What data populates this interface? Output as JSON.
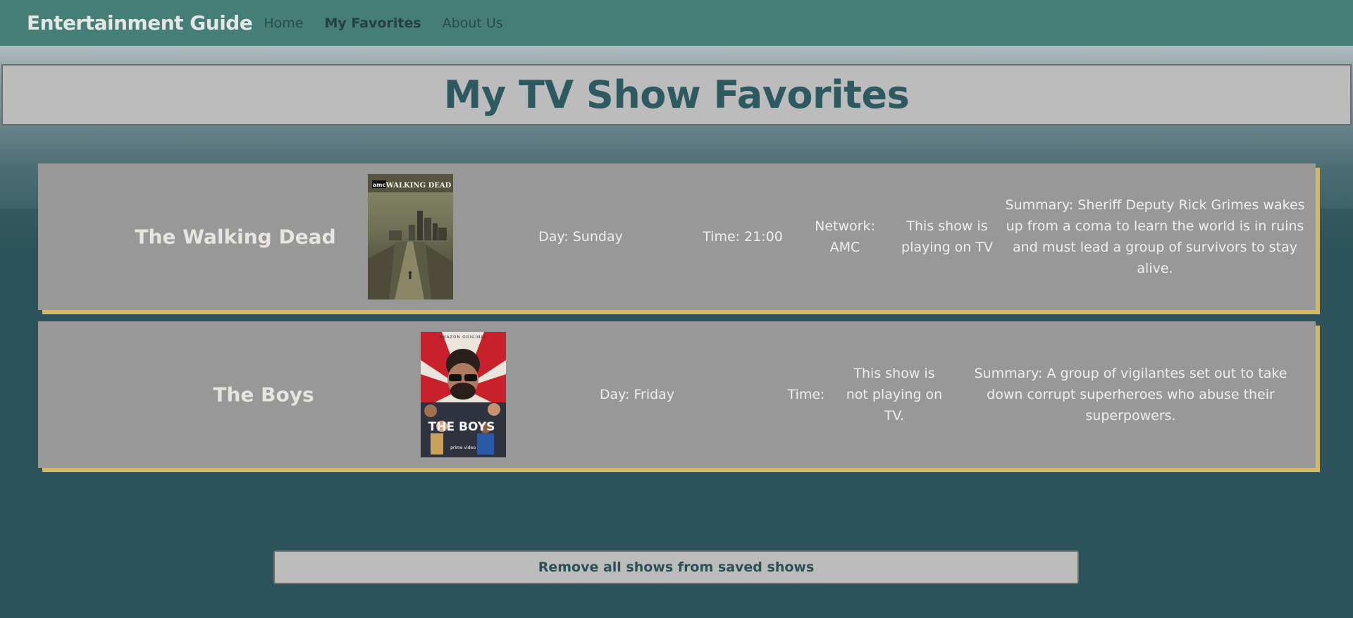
{
  "nav": {
    "brand": "Entertainment Guide",
    "links": [
      "Home",
      "My Favorites",
      "About Us"
    ]
  },
  "page_title": "My TV Show Favorites",
  "shows": [
    {
      "title": "The Walking Dead",
      "poster_icon": "walking-dead-poster",
      "day": "Day: Sunday",
      "time": "Time: 21:00",
      "network": "Network: AMC",
      "status": "This show is playing on TV",
      "summary": "Summary: Sheriff Deputy Rick Grimes wakes up from a coma to learn the world is in ruins and must lead a group of survivors to stay alive."
    },
    {
      "title": "The Boys",
      "poster_icon": "the-boys-poster",
      "day": "Day: Friday",
      "time": "Time:",
      "status": "This show is not playing on TV.",
      "summary": "Summary: A group of vigilantes set out to take down corrupt superheroes who abuse their superpowers."
    }
  ],
  "posters": {
    "twd_logo": "amc",
    "twd_title": "WALKING DEAD",
    "boys_top": "AMAZON ORIGINAL",
    "boys_title": "THE BOYS",
    "boys_bottom": "prime video"
  },
  "remove_all_label": "Remove all shows from saved shows",
  "colors": {
    "nav_bg": "#457d77",
    "card_bg": "#989898",
    "card_shadow": "#d4b86a",
    "title_color": "#2d5a61",
    "page_bg": "#2c535b"
  }
}
